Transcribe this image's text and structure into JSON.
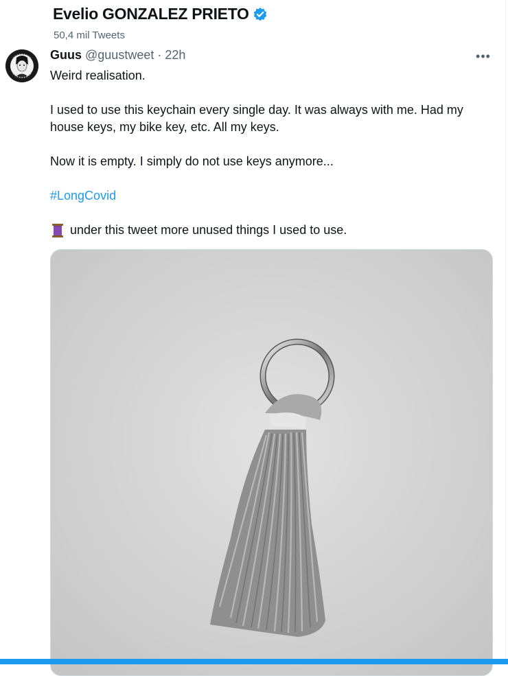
{
  "header": {
    "title": "Evelio GONZALEZ PRIETO",
    "tweet_count": "50,4 mil Tweets"
  },
  "tweet": {
    "author_name": "Guus",
    "author_handle": "@guustweet",
    "separator": "·",
    "time": "22h",
    "more_label": "•••",
    "lines": [
      "Weird realisation.",
      "I used to use this keychain every single day. It was always with me. Had my house keys, my bike key, etc. All my keys.",
      "Now it is empty. I simply do not use keys anymore...",
      "#LongCovid",
      "under this tweet more unused things I used to use."
    ],
    "thread_emoji_icon": "spool-of-thread-icon",
    "media_description_icon": "keychain-tassel-photo"
  },
  "colors": {
    "accent": "#1d9bf0",
    "text": "#0f1419",
    "secondary": "#536471",
    "border": "#cfd9de"
  }
}
